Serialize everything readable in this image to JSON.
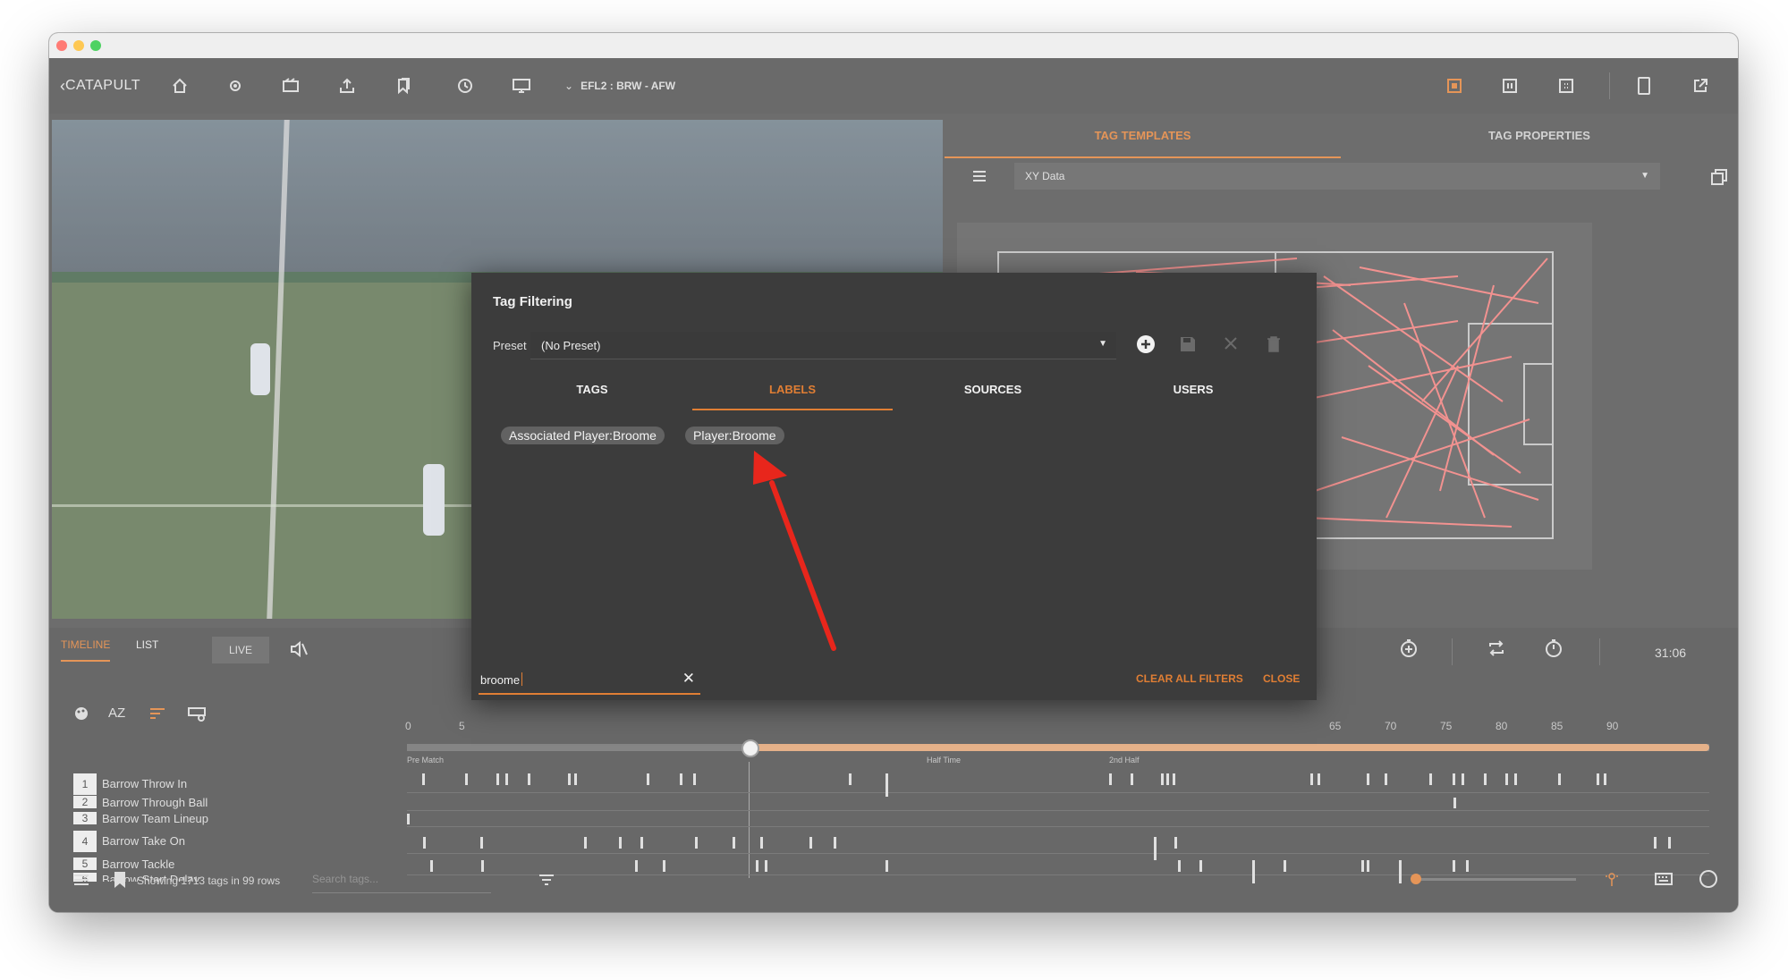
{
  "toolbar": {
    "brand": "CATAPULT",
    "match": "EFL2 : BRW - AFW"
  },
  "right_panel": {
    "tabs": [
      "TAG TEMPLATES",
      "TAG PROPERTIES"
    ],
    "template_select": "XY Data"
  },
  "dialog": {
    "title": "Tag Filtering",
    "preset_label": "Preset",
    "preset_value": "(No Preset)",
    "tabs": [
      "TAGS",
      "LABELS",
      "SOURCES",
      "USERS"
    ],
    "active_tab": "LABELS",
    "chips": [
      "Associated Player:Broome",
      "Player:Broome"
    ],
    "search_value": "broome",
    "clear_label": "CLEAR ALL FILTERS",
    "close_label": "CLOSE"
  },
  "bottom": {
    "tabs": [
      "TIMELINE",
      "LIST"
    ],
    "live_label": "LIVE",
    "time": "31:06",
    "axis_ticks": [
      "0",
      "5",
      "65",
      "70",
      "75",
      "80",
      "85",
      "90"
    ],
    "markers": [
      "Pre Match",
      "Half Time",
      "2nd Half"
    ],
    "rows": [
      {
        "num": "1",
        "label": "Barrow Throw In"
      },
      {
        "num": "2",
        "label": "Barrow Through Ball"
      },
      {
        "num": "3",
        "label": "Barrow Team Lineup"
      },
      {
        "num": "4",
        "label": "Barrow Take On"
      },
      {
        "num": "5",
        "label": "Barrow Tackle"
      },
      {
        "num": "6",
        "label": "Barrow Start Delay"
      }
    ],
    "status": "Showing 1713 tags in 99 rows",
    "search_placeholder": "Search tags..."
  },
  "colors": {
    "accent": "#e07e34",
    "annotation_arrow": "#e8261c",
    "chip": "#626262",
    "dialog_bg": "#3c3c3c"
  }
}
